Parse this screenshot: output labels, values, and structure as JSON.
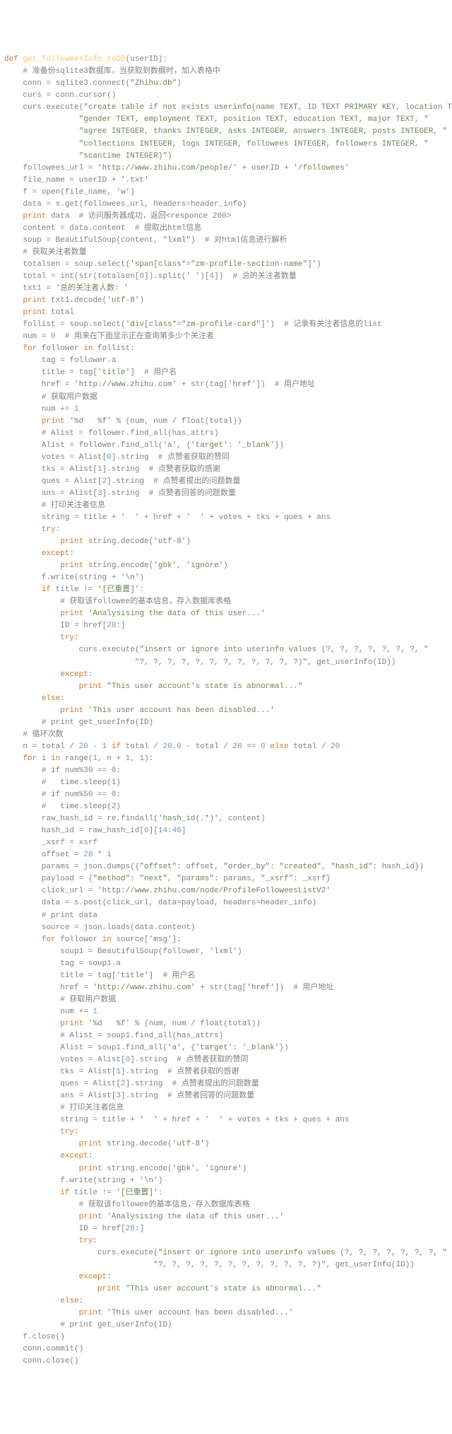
{
  "lines": [
    {
      "i": 0,
      "html": "<span class='kw'>def</span> <span class='fn'>get_followeesInfo_toDB</span>(userID):"
    },
    {
      "i": 1,
      "html": "<span class='cmt'># 准备份sqlite3数据库，当获取到数据时，加入表格中</span>"
    },
    {
      "i": 1,
      "html": "conn = sqlite3.connect(<span class='str'>\"Zhihu.db\"</span>)"
    },
    {
      "i": 1,
      "html": "curs = conn.cursor()"
    },
    {
      "i": 1,
      "html": "curs.execute(<span class='str'>\"create table if not exists userinfo(name TEXT, ID TEXT PRIMARY KEY, location TEXT, business TEXT, \"</span>"
    },
    {
      "i": 4,
      "html": "<span class='str'>\"gender TEXT, employment TEXT, position TEXT, education TEXT, major TEXT, \"</span>"
    },
    {
      "i": 4,
      "html": "<span class='str'>\"agree INTEGER, thanks INTEGER, asks INTEGER, answers INTEGER, posts INTEGER, \"</span>"
    },
    {
      "i": 4,
      "html": "<span class='str'>\"collections INTEGER, logs INTEGER, followees INTEGER, followers INTEGER, \"</span>"
    },
    {
      "i": 4,
      "html": "<span class='str'>\"scantime INTEGER)\"</span>)"
    },
    {
      "i": 1,
      "html": "followees_url = <span class='str'>'http://www.zhihu.com/people/'</span> + userID + <span class='str'>'/followees'</span>"
    },
    {
      "i": 1,
      "html": "file_name = userID + <span class='str'>'.txt'</span>"
    },
    {
      "i": 1,
      "html": "f = open(file_name, <span class='str'>'w'</span>)"
    },
    {
      "i": 1,
      "html": "data = s.get(followees_url, headers=header_info)"
    },
    {
      "i": 1,
      "html": "<span class='kw'>print</span> data  <span class='cmt'># 访问服务器成功，返回&lt;responce 200&gt;</span>"
    },
    {
      "i": 1,
      "html": "content = data.content  <span class='cmt'># 提取出html信息</span>"
    },
    {
      "i": 1,
      "html": "soup = BeautifulSoup(content, <span class='str'>\"lxml\"</span>)  <span class='cmt'># 对html信息进行解析</span>"
    },
    {
      "i": 1,
      "html": "<span class='cmt'># 获取关注者数量</span>"
    },
    {
      "i": 1,
      "html": "totalsen = soup.select(<span class='str'>'span[class*=\"zm-profile-section-name\"]'</span>)"
    },
    {
      "i": 1,
      "html": "total = int(str(totalsen[<span class='num'>0</span>]).split(<span class='str'>' '</span>)[<span class='num'>4</span>])  <span class='cmt'># 总的关注者数量</span>"
    },
    {
      "i": 1,
      "html": "txt1 = <span class='str'>'总的关注者人数: '</span>"
    },
    {
      "i": 1,
      "html": "<span class='kw'>print</span> txt1.decode(<span class='str'>'utf-8'</span>)"
    },
    {
      "i": 1,
      "html": "<span class='kw'>print</span> total"
    },
    {
      "i": 1,
      "html": "follist = soup.select(<span class='str'>'div[class*=\"zm-profile-card\"]'</span>)  <span class='cmt'># 记录有关注者信息的list</span>"
    },
    {
      "i": 1,
      "html": "num = <span class='num'>0</span>  <span class='cmt'># 用来在下面显示正在查询第多少个关注者</span>"
    },
    {
      "i": 1,
      "html": "<span class='kw'>for</span> follower <span class='kw'>in</span> follist:"
    },
    {
      "i": 2,
      "html": "tag = follower.a"
    },
    {
      "i": 2,
      "html": "title = tag[<span class='str'>'title'</span>]  <span class='cmt'># 用户名</span>"
    },
    {
      "i": 2,
      "html": "href = <span class='str'>'http://www.zhihu.com'</span> + str(tag[<span class='str'>'href'</span>])  <span class='cmt'># 用户地址</span>"
    },
    {
      "i": 2,
      "html": "<span class='cmt'># 获取用户数据</span>"
    },
    {
      "i": 2,
      "html": "num += <span class='num'>1</span>"
    },
    {
      "i": 2,
      "html": "<span class='kw'>print</span> <span class='str'>'%d   %f'</span> % (num, num / float(total))"
    },
    {
      "i": 2,
      "html": "<span class='cmt'># Alist = follower.find_all(has_attrs)</span>"
    },
    {
      "i": 2,
      "html": "Alist = follower.find_all(<span class='str'>'a'</span>, {<span class='str'>'target'</span>: <span class='str'>'_blank'</span>})"
    },
    {
      "i": 2,
      "html": "votes = Alist[<span class='num'>0</span>].string  <span class='cmt'># 点赞者获取的赞同</span>"
    },
    {
      "i": 2,
      "html": "tks = Alist[<span class='num'>1</span>].string  <span class='cmt'># 点赞者获取的感谢</span>"
    },
    {
      "i": 2,
      "html": "ques = Alist[<span class='num'>2</span>].string  <span class='cmt'># 点赞者提出的问题数量</span>"
    },
    {
      "i": 2,
      "html": "ans = Alist[<span class='num'>3</span>].string  <span class='cmt'># 点赞者回答的问题数量</span>"
    },
    {
      "i": 2,
      "html": "<span class='cmt'># 打印关注者信息</span>"
    },
    {
      "i": 2,
      "html": "string = title + <span class='str'>'  '</span> + href + <span class='str'>'  '</span> + votes + tks + ques + ans"
    },
    {
      "i": 2,
      "html": "<span class='kw'>try</span>:"
    },
    {
      "i": 3,
      "html": "<span class='kw'>print</span> string.decode(<span class='str'>'utf-8'</span>)"
    },
    {
      "i": 2,
      "html": "<span class='kw'>except</span>:"
    },
    {
      "i": 3,
      "html": "<span class='kw'>print</span> string.encode(<span class='str'>'gbk'</span>, <span class='str'>'ignore'</span>)"
    },
    {
      "i": 2,
      "html": "f.write(string + <span class='str'>'\\n'</span>)"
    },
    {
      "i": 2,
      "html": "<span class='kw'>if</span> title != <span class='str'>'[已重置]'</span>:"
    },
    {
      "i": 3,
      "html": "<span class='cmt'># 获取该followee的基本信息，存入数据库表格</span>"
    },
    {
      "i": 3,
      "html": "<span class='kw'>print</span> <span class='str'>'Analysising the data of this user...'</span>"
    },
    {
      "i": 3,
      "html": "ID = href[<span class='num'>28</span>:]"
    },
    {
      "i": 3,
      "html": "<span class='kw'>try</span>:"
    },
    {
      "i": 4,
      "html": "curs.execute(<span class='str'>\"insert or ignore into userinfo values (?, ?, ?, ?, ?, ?, ?, \"</span>"
    },
    {
      "i": 7,
      "html": "<span class='str'>\"?, ?, ?, ?, ?, ?, ?, ?, ?, ?, ?, ?)\"</span>, get_userInfo(ID))"
    },
    {
      "i": 3,
      "html": "<span class='kw'>except</span>:"
    },
    {
      "i": 4,
      "html": "<span class='kw'>print</span> <span class='str'>\"This user account's state is abnormal...\"</span>"
    },
    {
      "i": 2,
      "html": "<span class='kw'>else</span>:"
    },
    {
      "i": 3,
      "html": "<span class='kw'>print</span> <span class='str'>'This user account has been disabled...'</span>"
    },
    {
      "i": 2,
      "html": "<span class='cmt'># print get_userInfo(ID)</span>"
    },
    {
      "i": 0,
      "html": ""
    },
    {
      "i": 1,
      "html": "<span class='cmt'># 循环次数</span>"
    },
    {
      "i": 1,
      "html": "n = total / <span class='num'>20</span> - <span class='num'>1</span> <span class='kw'>if</span> total / <span class='num'>20.0</span> - total / <span class='num'>20</span> == <span class='num'>0</span> <span class='kw'>else</span> total / <span class='num'>20</span>"
    },
    {
      "i": 1,
      "html": "<span class='kw'>for</span> i <span class='kw'>in</span> range(<span class='num'>1</span>, n + <span class='num'>1</span>, <span class='num'>1</span>):"
    },
    {
      "i": 2,
      "html": "<span class='cmt'># if num%30 == 0:</span>"
    },
    {
      "i": 2,
      "html": "<span class='cmt'>#   time.sleep(1)</span>"
    },
    {
      "i": 2,
      "html": "<span class='cmt'># if num%50 == 0:</span>"
    },
    {
      "i": 2,
      "html": "<span class='cmt'>#   time.sleep(2)</span>"
    },
    {
      "i": 2,
      "html": "raw_hash_id = re.findall(<span class='str'>'hash_id(.*)'</span>, content)"
    },
    {
      "i": 2,
      "html": "hash_id = raw_hash_id[<span class='num'>0</span>][<span class='num'>14</span>:<span class='num'>46</span>]"
    },
    {
      "i": 2,
      "html": "_xsrf = xsrf"
    },
    {
      "i": 2,
      "html": "offset = <span class='num'>20</span> * i"
    },
    {
      "i": 2,
      "html": "params = json.dumps({<span class='str'>\"offset\"</span>: offset, <span class='str'>\"order_by\"</span>: <span class='str'>\"created\"</span>, <span class='str'>\"hash_id\"</span>: hash_id})"
    },
    {
      "i": 2,
      "html": "payload = {<span class='str'>\"method\"</span>: <span class='str'>\"next\"</span>, <span class='str'>\"params\"</span>: params, <span class='str'>\"_xsrf\"</span>: _xsrf}"
    },
    {
      "i": 2,
      "html": "click_url = <span class='str'>'http://www.zhihu.com/node/ProfileFolloweesListV2'</span>"
    },
    {
      "i": 2,
      "html": "data = s.post(click_url, data=payload, headers=header_info)"
    },
    {
      "i": 2,
      "html": "<span class='cmt'># print data</span>"
    },
    {
      "i": 2,
      "html": "source = json.loads(data.content)"
    },
    {
      "i": 2,
      "html": "<span class='kw'>for</span> follower <span class='kw'>in</span> source[<span class='str'>'msg'</span>]:"
    },
    {
      "i": 3,
      "html": "soup1 = BeautifulSoup(follower, <span class='str'>'lxml'</span>)"
    },
    {
      "i": 3,
      "html": "tag = soup1.a"
    },
    {
      "i": 3,
      "html": "title = tag[<span class='str'>'title'</span>]  <span class='cmt'># 用户名</span>"
    },
    {
      "i": 3,
      "html": "href = <span class='str'>'http://www.zhihu.com'</span> + str(tag[<span class='str'>'href'</span>])  <span class='cmt'># 用户地址</span>"
    },
    {
      "i": 3,
      "html": "<span class='cmt'># 获取用户数据</span>"
    },
    {
      "i": 3,
      "html": "num += <span class='num'>1</span>"
    },
    {
      "i": 3,
      "html": "<span class='kw'>print</span> <span class='str'>'%d   %f'</span> % (num, num / float(total))"
    },
    {
      "i": 3,
      "html": "<span class='cmt'># Alist = soup1.find_all(has_attrs)</span>"
    },
    {
      "i": 3,
      "html": "Alist = soup1.find_all(<span class='str'>'a'</span>, {<span class='str'>'target'</span>: <span class='str'>'_blank'</span>})"
    },
    {
      "i": 3,
      "html": "votes = Alist[<span class='num'>0</span>].string  <span class='cmt'># 点赞者获取的赞同</span>"
    },
    {
      "i": 3,
      "html": "tks = Alist[<span class='num'>1</span>].string  <span class='cmt'># 点赞者获取的感谢</span>"
    },
    {
      "i": 3,
      "html": "ques = Alist[<span class='num'>2</span>].string  <span class='cmt'># 点赞者提出的问题数量</span>"
    },
    {
      "i": 3,
      "html": "ans = Alist[<span class='num'>3</span>].string  <span class='cmt'># 点赞者回答的问题数量</span>"
    },
    {
      "i": 3,
      "html": "<span class='cmt'># 打印关注者信息</span>"
    },
    {
      "i": 3,
      "html": "string = title + <span class='str'>'  '</span> + href + <span class='str'>'  '</span> + votes + tks + ques + ans"
    },
    {
      "i": 3,
      "html": "<span class='kw'>try</span>:"
    },
    {
      "i": 4,
      "html": "<span class='kw'>print</span> string.decode(<span class='str'>'utf-8'</span>)"
    },
    {
      "i": 3,
      "html": "<span class='kw'>except</span>:"
    },
    {
      "i": 4,
      "html": "<span class='kw'>print</span> string.encode(<span class='str'>'gbk'</span>, <span class='str'>'ignore'</span>)"
    },
    {
      "i": 3,
      "html": "f.write(string + <span class='str'>'\\n'</span>)"
    },
    {
      "i": 3,
      "html": "<span class='kw'>if</span> title != <span class='str'>'[已重置]'</span>:"
    },
    {
      "i": 4,
      "html": "<span class='cmt'># 获取该followee的基本信息，存入数据库表格</span>"
    },
    {
      "i": 4,
      "html": "<span class='kw'>print</span> <span class='str'>'Analysising the data of this user...'</span>"
    },
    {
      "i": 4,
      "html": "ID = href[<span class='num'>28</span>:]"
    },
    {
      "i": 4,
      "html": "<span class='kw'>try</span>:"
    },
    {
      "i": 5,
      "html": "curs.execute(<span class='str'>\"insert or ignore into userinfo values (?, ?, ?, ?, ?, ?, ?, \"</span>"
    },
    {
      "i": 8,
      "html": "<span class='str'>\"?, ?, ?, ?, ?, ?, ?, ?, ?, ?, ?, ?)\"</span>, get_userInfo(ID))"
    },
    {
      "i": 4,
      "html": "<span class='kw'>except</span>:"
    },
    {
      "i": 5,
      "html": "<span class='kw'>print</span> <span class='str'>\"This user account's state is abnormal...\"</span>"
    },
    {
      "i": 3,
      "html": "<span class='kw'>else</span>:"
    },
    {
      "i": 4,
      "html": "<span class='kw'>print</span> <span class='str'>'This user account has been disabled...'</span>"
    },
    {
      "i": 3,
      "html": "<span class='cmt'># print get_userInfo(ID)</span>"
    },
    {
      "i": 1,
      "html": "f.close()"
    },
    {
      "i": 1,
      "html": "conn.commit()"
    },
    {
      "i": 1,
      "html": "conn.close()"
    }
  ],
  "indent_unit": "    "
}
